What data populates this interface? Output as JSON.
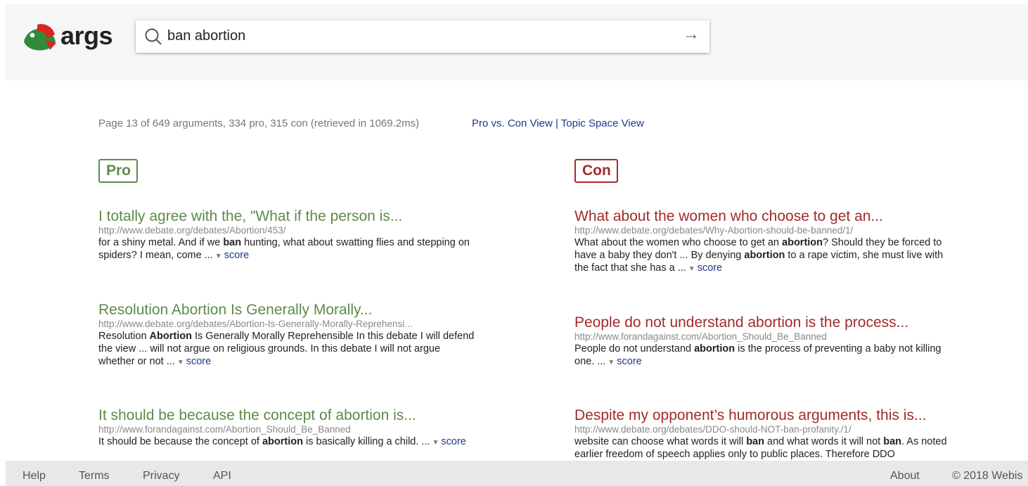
{
  "app": {
    "logo_text": "args"
  },
  "search": {
    "query": "ban abortion"
  },
  "meta": {
    "summary": "Page 13 of 649 arguments, 334 pro, 315 con (retrieved in 1069.2ms)",
    "view_pro_con": "Pro vs. Con View",
    "separator": "|",
    "view_topic": "Topic Space View"
  },
  "pro": {
    "label": "Pro",
    "results": [
      {
        "title": "I totally agree with the, \"What if the person is...",
        "url": "http://www.debate.org/debates/Abortion/453/",
        "snippet": [
          {
            "t": "for a shiny metal. And if we "
          },
          {
            "b": "ban"
          },
          {
            "t": " hunting, what about swatting flies and stepping on spiders? I mean, come ..."
          }
        ],
        "score": "score"
      },
      {
        "title": "Resolution Abortion Is Generally Morally...",
        "url": "http://www.debate.org/debates/Abortion-Is-Generally-Morally-Reprehensi...",
        "snippet": [
          {
            "t": "Resolution "
          },
          {
            "b": "Abortion"
          },
          {
            "t": " Is Generally Morally Reprehensible In this debate I will defend the view ... will not argue on religious grounds. In this debate I will not argue whether or not ..."
          }
        ],
        "score": "score"
      },
      {
        "title": "It should be because the concept of abortion is...",
        "url": "http://www.forandagainst.com/Abortion_Should_Be_Banned",
        "snippet": [
          {
            "t": "It should be because the concept of "
          },
          {
            "b": "abortion"
          },
          {
            "t": " is basically killing a child. ..."
          }
        ],
        "score": "score"
      }
    ]
  },
  "con": {
    "label": "Con",
    "results": [
      {
        "title": "What about the women who choose to get an...",
        "url": "http://www.debate.org/debates/Why-Abortion-should-be-banned/1/",
        "snippet": [
          {
            "t": "What about the women who choose to get an "
          },
          {
            "b": "abortion"
          },
          {
            "t": "? Should they be forced to have a baby they don't ... By denying "
          },
          {
            "b": "abortion"
          },
          {
            "t": " to a rape victim, she must live with the fact that she has a ..."
          }
        ],
        "score": "score"
      },
      {
        "title": "People do not understand abortion is the process...",
        "url": "http://www.forandagainst.com/Abortion_Should_Be_Banned",
        "snippet": [
          {
            "t": "People do not understand "
          },
          {
            "b": "abortion"
          },
          {
            "t": " is the process of preventing a baby not killing one. ..."
          }
        ],
        "score": "score"
      },
      {
        "title": "Despite my opponent’s humorous arguments, this is...",
        "url": "http://www.debate.org/debates/DDO-should-NOT-ban-profanity./1/",
        "snippet": [
          {
            "t": "website can choose what words it will "
          },
          {
            "b": "ban"
          },
          {
            "t": " and what words it will not "
          },
          {
            "b": "ban"
          },
          {
            "t": ". As noted earlier freedom of speech applies only to public places. Therefore DDO"
          }
        ],
        "score": ""
      }
    ]
  },
  "footer": {
    "help": "Help",
    "terms": "Terms",
    "privacy": "Privacy",
    "api": "API",
    "about": "About",
    "copyright": "© 2018 Webis"
  },
  "colors": {
    "pro": "#5d8a4b",
    "con": "#a22b2b",
    "link": "#1a3a8c"
  },
  "icons": {
    "logo": "parrot-logo-icon",
    "search": "search-icon",
    "submit": "arrow-right-icon",
    "expand": "triangle-down-icon"
  }
}
